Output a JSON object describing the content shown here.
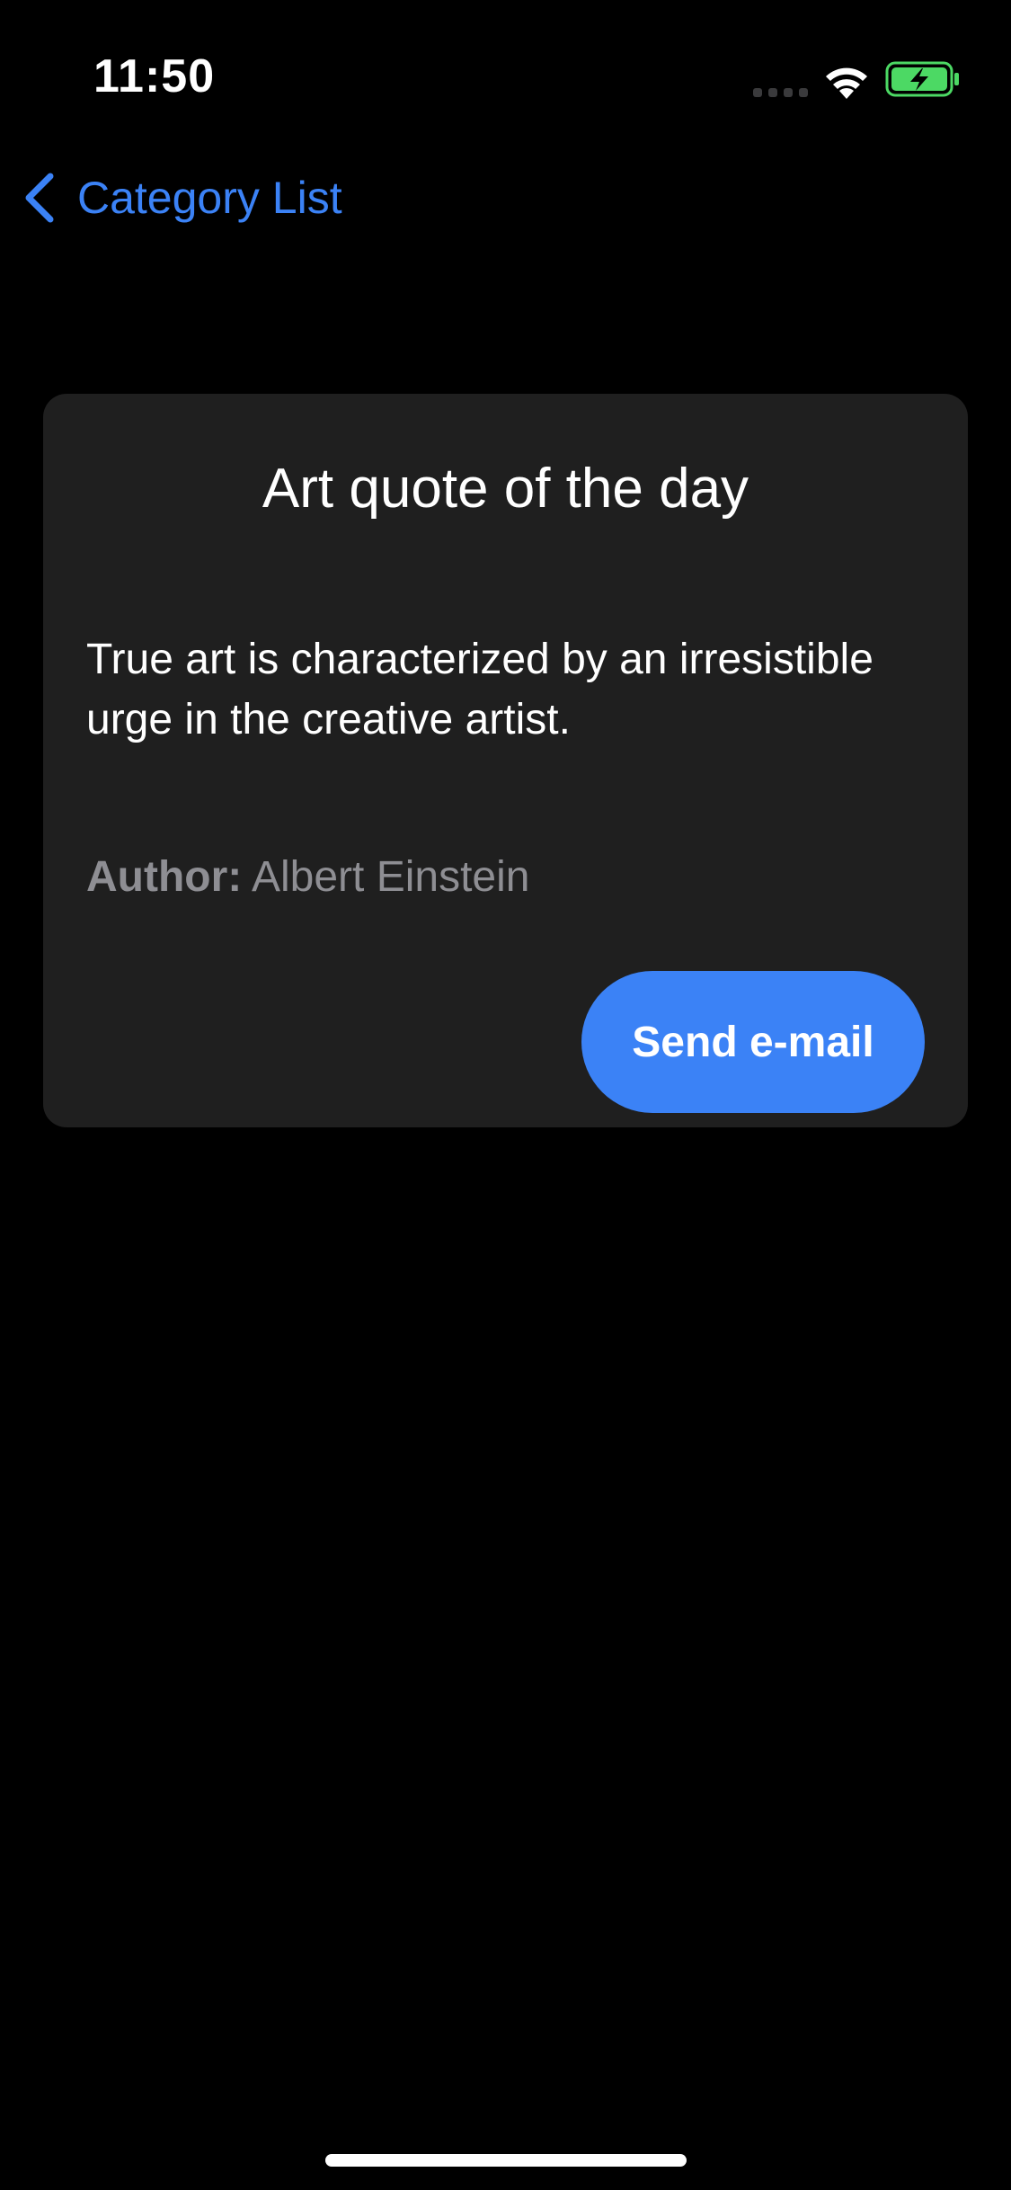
{
  "status_bar": {
    "time": "11:50",
    "icons": [
      "signal-dots-icon",
      "wifi-icon",
      "battery-charging-icon"
    ],
    "battery_color": "#4cd964"
  },
  "nav": {
    "back_label": "Category List",
    "back_icon": "chevron-left-icon",
    "accent_color": "#3b82f6"
  },
  "card": {
    "title": "Art quote of the day",
    "quote": "True art is characterized by an irresistible urge in the creative artist.",
    "author_label": "Author:",
    "author_name": "Albert Einstein",
    "send_button_label": "Send e-mail"
  }
}
